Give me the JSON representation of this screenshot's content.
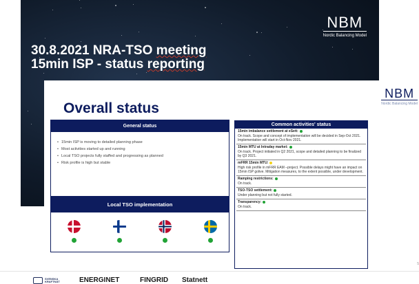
{
  "title_slide": {
    "line1_prefix": "30.8.2021 NRA-TSO ",
    "line1_underlined": "meeting",
    "line2_prefix": "15min ISP - status ",
    "line2_underlined": "reporting",
    "logo": "NBM",
    "logo_sub": "Nordic Balancing Model"
  },
  "status_slide": {
    "title": "Overall status",
    "logo": "NBM",
    "logo_sub": "Nordic Balancing Model",
    "general": {
      "header": "General status",
      "items": [
        "15min ISP is moving to detailed planning phase",
        "Most activities started up and running",
        "Local TSO projects fully staffed and progressing as planned",
        "Risk profile is high but stable"
      ]
    },
    "local": {
      "header": "Local TSO implementation",
      "flags": [
        {
          "icon": "denmark-flag-icon",
          "status": "green"
        },
        {
          "icon": "finland-flag-icon",
          "status": "green"
        },
        {
          "icon": "norway-flag-icon",
          "status": "green"
        },
        {
          "icon": "sweden-flag-icon",
          "status": "green"
        }
      ]
    },
    "common": {
      "header": "Common activities' status",
      "items": [
        {
          "title": "15min imbalance settlement at eSett:",
          "status": "green",
          "desc": "On track. Scope and concept of implementation will be decided in Sep-Oct 2021. Implementation will start in Oct-Nov 2021."
        },
        {
          "title": "15min MTU at Intraday market:",
          "status": "green",
          "desc": "On track. Project initiated in Q2 2021, scope and detailed planning to be finalized by Q3 2021."
        },
        {
          "title": "mFRR 15min MTU:",
          "status": "yellow",
          "desc": "High risk profile in mFRR EAM –project. Possible delays might have an impact on 15min ISP golive. Mitigation measures, to the extent possible, under development."
        },
        {
          "title": "Ramping restrictions:",
          "status": "green",
          "desc": "On track."
        },
        {
          "title": "TSO-TSO settlement:",
          "status": "green",
          "desc": "Under planning but not fully started."
        },
        {
          "title": "Transparency:",
          "status": "green",
          "desc": "On track."
        }
      ]
    },
    "page_number": "5"
  },
  "footer": {
    "svk_line1": "SVENSKA",
    "svk_line2": "KRAFTNÄT",
    "energinet": "ENERGINET",
    "fingrid": "FINGRID",
    "statnett": "Statnett"
  },
  "colors": {
    "navy": "#0d1c5e",
    "status_green": "#21a336",
    "status_yellow": "#f2d21a"
  }
}
